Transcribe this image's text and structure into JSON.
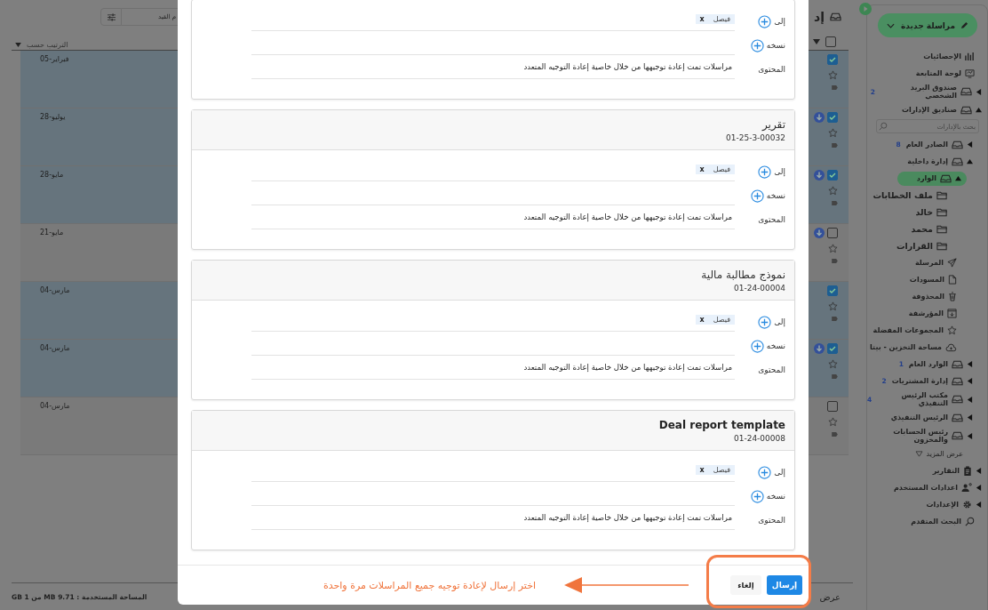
{
  "mail_list": {
    "title": "إد",
    "select_all": {
      "checked": false
    },
    "search_placeholder": "م القيد",
    "sort_label": "الترتيب حسب",
    "rows": [
      {
        "date": "05-فبراير",
        "checked": true,
        "download": false
      },
      {
        "date": "28-يوليو",
        "checked": true,
        "download": true
      },
      {
        "date": "28-مايو",
        "checked": true,
        "download": true
      },
      {
        "date": "21-مايو",
        "checked": false,
        "download": true
      },
      {
        "date": "04-مارس",
        "checked": true,
        "download": false
      },
      {
        "date": "04-مارس",
        "checked": true,
        "download": true
      },
      {
        "date": "04-مارس",
        "checked": false,
        "download": false
      }
    ],
    "storage": "المساحة المستخدمة : 9.71 MB من 1 GB",
    "view_label": "عرض"
  },
  "sidebar": {
    "new_message_button": "مراسلة جديدة",
    "items": [
      {
        "kind": "stats",
        "label": "الإحصائيات",
        "selected": false
      },
      {
        "kind": "dashboard",
        "label": "لوحة المتابعة",
        "selected": false
      },
      {
        "kind": "mailbox",
        "label": "صندوق البريد الشخصي",
        "badge": "2",
        "expanded": false,
        "selected": false
      },
      {
        "kind": "mailbox",
        "label": "صناديق الإدارات",
        "expanded": true,
        "selected": false,
        "children": [
          {
            "kind": "search_box",
            "placeholder": "بحث بالإدارات"
          },
          {
            "kind": "mailbox",
            "label": "الصادر العام",
            "badge": "8",
            "expanded": false,
            "selected": false
          },
          {
            "kind": "mailbox",
            "label": "إدارة داخلية",
            "expanded": true,
            "selected": false,
            "children": [
              {
                "kind": "mailbox",
                "label": "الوارد",
                "expanded": true,
                "selected": true,
                "children": [
                  {
                    "kind": "folder",
                    "label": "ملف الخطابات",
                    "selected": false
                  },
                  {
                    "kind": "folder",
                    "label": "خالد",
                    "selected": false
                  },
                  {
                    "kind": "folder",
                    "label": "محمد",
                    "selected": false
                  },
                  {
                    "kind": "folder",
                    "label": "القرارات",
                    "selected": false
                  }
                ]
              },
              {
                "kind": "sent",
                "label": "المرسلة",
                "selected": false
              },
              {
                "kind": "drafts",
                "label": "المسودات",
                "selected": false
              },
              {
                "kind": "trash",
                "label": "المحذوفة",
                "selected": false
              },
              {
                "kind": "archive",
                "label": "المؤرشفة",
                "selected": false
              },
              {
                "kind": "favorites",
                "label": "المجموعات المفضلة",
                "selected": false
              },
              {
                "kind": "cloud",
                "label": "مساحة التخزين - بيتا",
                "selected": false
              }
            ]
          },
          {
            "kind": "mailbox",
            "label": "الوارد العام",
            "badge": "1",
            "expanded": false,
            "selected": false
          },
          {
            "kind": "mailbox",
            "label": "إدارة المشتريات",
            "badge": "2",
            "expanded": false,
            "selected": false
          },
          {
            "kind": "mailbox",
            "label": "مكتب الرئيس التنفيذي",
            "badge": "4",
            "expanded": false,
            "selected": false
          },
          {
            "kind": "mailbox",
            "label": "الرئيس التنفيذي",
            "expanded": false,
            "selected": false
          },
          {
            "kind": "mailbox",
            "label": "رئيس الحسابات والمخزون",
            "expanded": false,
            "selected": false
          },
          {
            "kind": "more",
            "label": "عرض المزيد"
          }
        ]
      },
      {
        "kind": "reports",
        "label": "التقارير",
        "expanded": false,
        "selected": false
      },
      {
        "kind": "user_settings",
        "label": "اعدادات المستخدم",
        "expanded": false,
        "selected": false
      },
      {
        "kind": "settings",
        "label": "الإعدادات",
        "expanded": false,
        "selected": false
      },
      {
        "kind": "advanced_search",
        "label": "البحث المتقدم",
        "selected": false
      }
    ]
  },
  "dialog": {
    "cards": [
      {
        "to_label": "إلى",
        "recipient": "فيصل",
        "remove": "x",
        "cc_label": "نسخه",
        "content_label": "المحتوى",
        "content": "مراسلات تمت إعادة توجيهها من خلال خاصية إعادة التوجيه المتعدد"
      },
      {
        "title": "تقرير",
        "number": "01-25-3-00032",
        "to_label": "إلى",
        "recipient": "فيصل",
        "remove": "x",
        "cc_label": "نسخه",
        "content_label": "المحتوى",
        "content": "مراسلات تمت إعادة توجيهها من خلال خاصية إعادة التوجيه المتعدد"
      },
      {
        "title": "نموذج مطالبة مالية",
        "number": "01-24-00004",
        "to_label": "إلى",
        "recipient": "فيصل",
        "remove": "x",
        "cc_label": "نسخه",
        "content_label": "المحتوى",
        "content": "مراسلات تمت إعادة توجيهها من خلال خاصية إعادة التوجيه المتعدد"
      },
      {
        "title": "Deal report template",
        "number": "01-24-00008",
        "to_label": "إلى",
        "recipient": "فيصل",
        "remove": "x",
        "cc_label": "نسخه",
        "content_label": "المحتوى",
        "content": "مراسلات تمت إعادة توجيهها من خلال خاصية إعادة التوجيه المتعدد"
      }
    ],
    "send_button": "إرسال",
    "cancel_button": "إلغاء"
  },
  "annotation": {
    "text": "اختر إرسال لإعادة توجيه جميع المراسلات مرة واحدة"
  }
}
